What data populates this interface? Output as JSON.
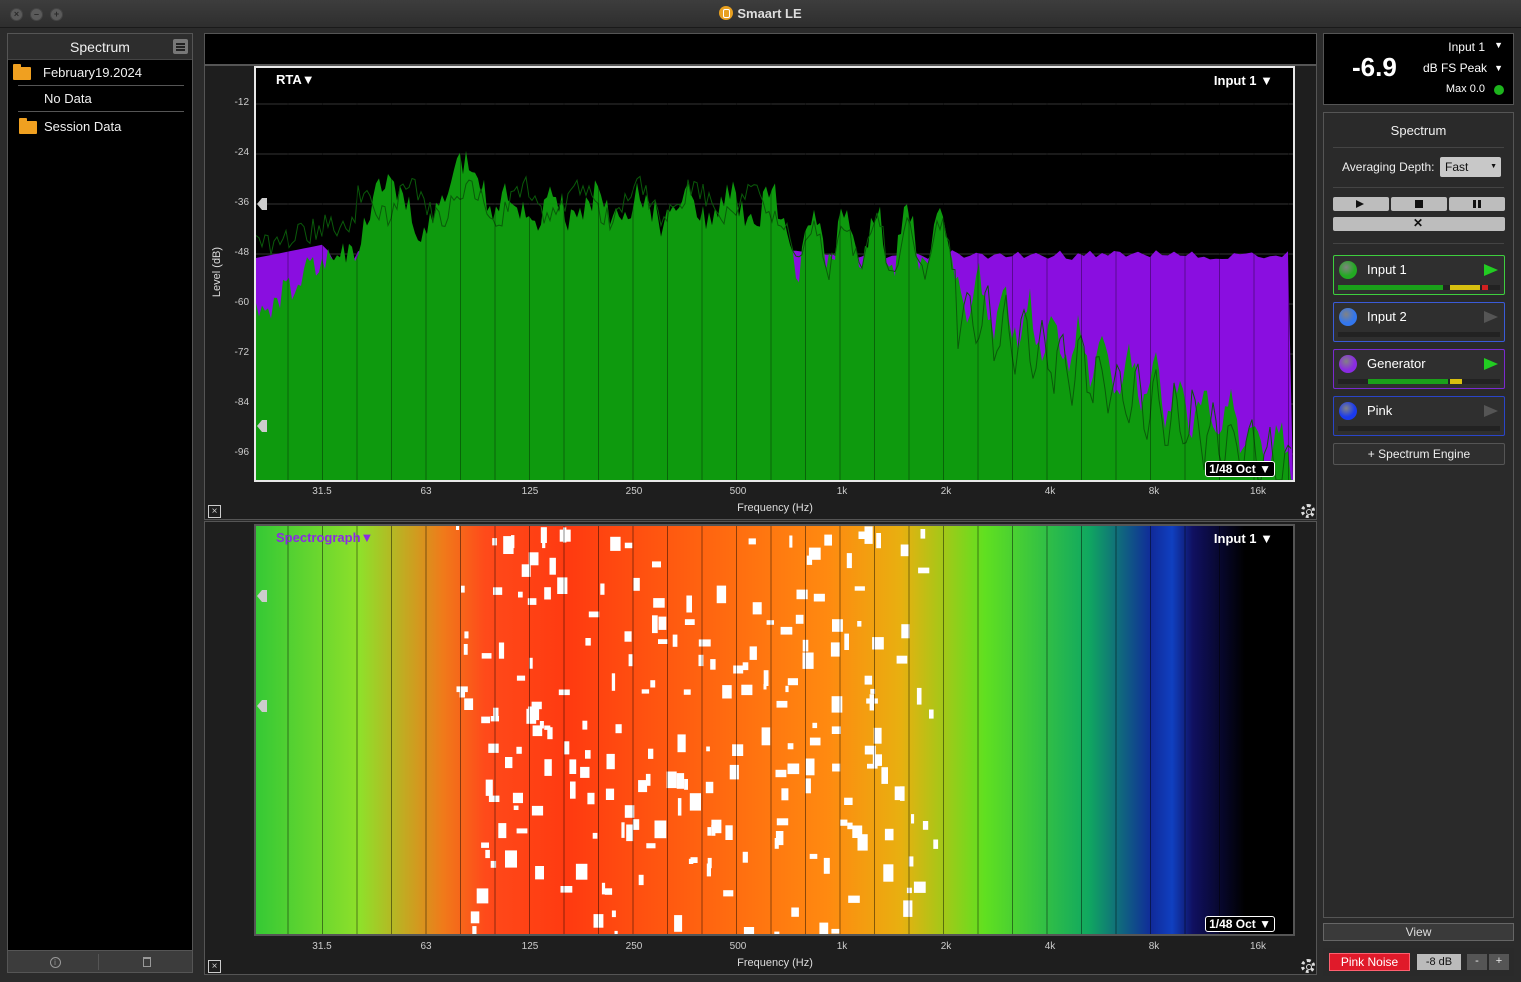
{
  "window": {
    "title": "Smaart LE"
  },
  "left_panel": {
    "title": "Spectrum",
    "items": [
      {
        "label": "February19.2024",
        "icon": "folder-open-icon"
      },
      {
        "label": "No Data"
      },
      {
        "label": "Session Data",
        "icon": "folder-icon"
      }
    ]
  },
  "rta": {
    "mode_label": "RTA▼",
    "input_label": "Input 1 ▼",
    "resolution_label": "1/48 Oct ▼",
    "ylabel": "Level (dB)",
    "xlabel": "Frequency (Hz)",
    "yticks": [
      "-12",
      "-24",
      "-36",
      "-48",
      "-60",
      "-72",
      "-84",
      "-96"
    ],
    "xticks": [
      "31.5",
      "63",
      "125",
      "250",
      "500",
      "1k",
      "2k",
      "4k",
      "8k",
      "16k"
    ],
    "colors": {
      "measured": "#0e9a0e",
      "reference": "#8a0ee0",
      "trace": "#0a5a0a"
    }
  },
  "spectrograph": {
    "mode_label": "Spectrograph▼",
    "input_label": "Input 1 ▼",
    "resolution_label": "1/48 Oct ▼",
    "xlabel": "Frequency (Hz)",
    "xticks": [
      "31.5",
      "63",
      "125",
      "250",
      "500",
      "1k",
      "2k",
      "4k",
      "8k",
      "16k"
    ]
  },
  "meter": {
    "source": "Input 1",
    "value": "-6.9",
    "unit": "dB FS Peak",
    "max": "Max 0.0",
    "status_color": "#1db41d"
  },
  "right_panel": {
    "title": "Spectrum",
    "averaging_label": "Averaging Depth:",
    "averaging_value": "Fast",
    "measurements": [
      {
        "name": "Input 1",
        "color": "#22aa22",
        "border": "#3ecf3e",
        "active": true
      },
      {
        "name": "Input 2",
        "color": "#3377ee",
        "border": "#3a5bd8",
        "active": false
      },
      {
        "name": "Generator",
        "color": "#8a2be2",
        "border": "#7a2ad0",
        "active": true
      },
      {
        "name": "Pink",
        "color": "#1a3aee",
        "border": "#2a45c8",
        "active": false
      }
    ],
    "add_engine_label": "+ Spectrum Engine",
    "view_label": "View"
  },
  "generator": {
    "label": "Pink Noise",
    "level": "-8 dB",
    "minus": "-",
    "plus": "+"
  }
}
